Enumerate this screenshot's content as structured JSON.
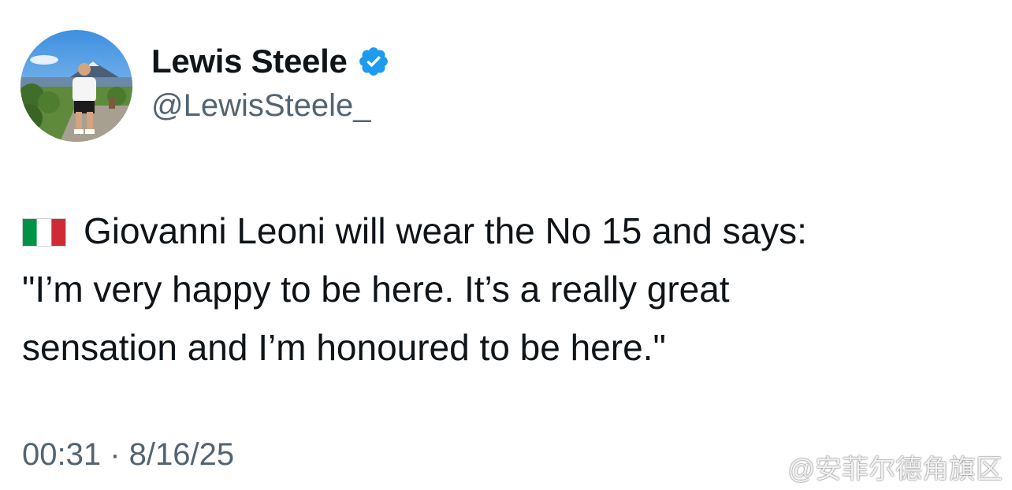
{
  "author": {
    "name": "Lewis Steele",
    "handle": "@LewisSteele_",
    "verified": true
  },
  "tweet": {
    "flag_icon": "italy-flag-icon",
    "lines": [
      "Giovanni Leoni will wear the No 15 and says:",
      "\"I’m very happy to be here. It’s a really great",
      "sensation and I’m honoured to be here.\""
    ]
  },
  "meta": {
    "time": "00:31",
    "separator": "·",
    "date": "8/16/25",
    "display": "00:31 · 8/16/25"
  },
  "watermark": {
    "text": "@安菲尔德角旗区",
    "icon": "weibo-logo-icon"
  },
  "colors": {
    "text": "#0f1419",
    "secondary": "#536471",
    "verified_badge": "#1d9bf0",
    "flag_green": "#009246",
    "flag_white": "#ffffff",
    "flag_red": "#ce2b37"
  }
}
